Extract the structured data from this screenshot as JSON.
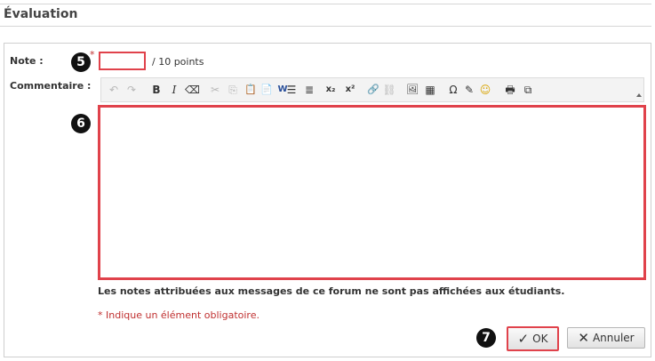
{
  "section": {
    "title": "Évaluation"
  },
  "form": {
    "note_label": "Note :",
    "required_mark": "*",
    "note_value": "",
    "points_suffix": "/ 10 points",
    "comment_label": "Commentaire :",
    "comment_value": "",
    "info_text": "Les notes attribuées aux messages de ce forum ne sont pas affichées aux étudiants.",
    "required_text": "* Indique un élément obligatoire."
  },
  "markers": {
    "note": "5",
    "comment": "6",
    "ok": "7"
  },
  "toolbar": {
    "undo": "↶",
    "redo": "↷",
    "bold": "B",
    "italic": "I",
    "eraser": "⌫",
    "cut": "✂",
    "copy": "⎘",
    "paste": "📋",
    "paste_text": "📄",
    "paste_word": "W",
    "bullets": "☰",
    "numbered": "≣",
    "subscript": "x₂",
    "superscript": "x²",
    "link": "🔗",
    "unlink": "⛓",
    "image": "🖼",
    "table": "▦",
    "omega": "Ω",
    "special": "✎",
    "smiley": "☺",
    "print": "🖶",
    "preview": "⧉"
  },
  "buttons": {
    "ok_label": "OK",
    "ok_icon": "✓",
    "cancel_label": "Annuler",
    "cancel_icon": "✕"
  },
  "colors": {
    "highlight": "#e0424b",
    "required": "#c03030"
  }
}
